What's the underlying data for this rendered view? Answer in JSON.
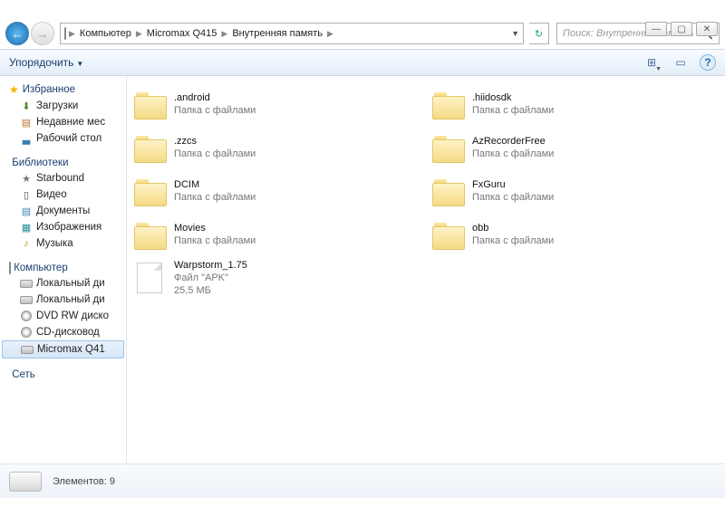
{
  "window_controls": {
    "min": "—",
    "max": "▢",
    "close": "✕"
  },
  "breadcrumb": {
    "icon": "computer-icon",
    "parts": [
      "Компьютер",
      "Micromax Q415",
      "Внутренняя память"
    ]
  },
  "nav": {
    "refresh": "↻"
  },
  "search": {
    "placeholder": "Поиск: Внутренняя память",
    "icon": "🔍"
  },
  "toolbar": {
    "organize": "Упорядочить",
    "views_icon": "⊞",
    "preview_icon": "▭",
    "help_icon": "?"
  },
  "sidebar": {
    "favorites": {
      "label": "Избранное",
      "items": [
        {
          "icon": "download-icon",
          "label": "Загрузки"
        },
        {
          "icon": "recent-icon",
          "label": "Недавние мес"
        },
        {
          "icon": "desktop-icon",
          "label": "Рабочий стол"
        }
      ]
    },
    "libraries": {
      "label": "Библиотеки",
      "items": [
        {
          "icon": "star-icon",
          "label": "Starbound"
        },
        {
          "icon": "video-icon",
          "label": "Видео"
        },
        {
          "icon": "documents-icon",
          "label": "Документы"
        },
        {
          "icon": "pictures-icon",
          "label": "Изображения"
        },
        {
          "icon": "music-icon",
          "label": "Музыка"
        }
      ]
    },
    "computer": {
      "label": "Компьютер",
      "items": [
        {
          "icon": "drive-icon",
          "label": "Локальный ди"
        },
        {
          "icon": "drive-icon",
          "label": "Локальный ди"
        },
        {
          "icon": "disc-icon",
          "label": "DVD RW диско"
        },
        {
          "icon": "disc-icon",
          "label": "CD-дисковод"
        },
        {
          "icon": "device-icon",
          "label": "Micromax Q41",
          "selected": true
        }
      ]
    },
    "network": {
      "label": "Сеть"
    }
  },
  "files": [
    {
      "type": "folder",
      "name": ".android",
      "sub": "Папка с файлами"
    },
    {
      "type": "folder",
      "name": ".hiidosdk",
      "sub": "Папка с файлами"
    },
    {
      "type": "folder",
      "name": ".zzcs",
      "sub": "Папка с файлами"
    },
    {
      "type": "folder",
      "name": "AzRecorderFree",
      "sub": "Папка с файлами"
    },
    {
      "type": "folder",
      "name": "DCIM",
      "sub": "Папка с файлами"
    },
    {
      "type": "folder",
      "name": "FxGuru",
      "sub": "Папка с файлами"
    },
    {
      "type": "folder",
      "name": "Movies",
      "sub": "Папка с файлами"
    },
    {
      "type": "folder",
      "name": "obb",
      "sub": "Папка с файлами"
    },
    {
      "type": "file",
      "name": "Warpstorm_1.75",
      "sub": "Файл \"APK\"",
      "sub2": "25,5 МБ"
    }
  ],
  "status": {
    "count_label": "Элементов:",
    "count": "9"
  }
}
